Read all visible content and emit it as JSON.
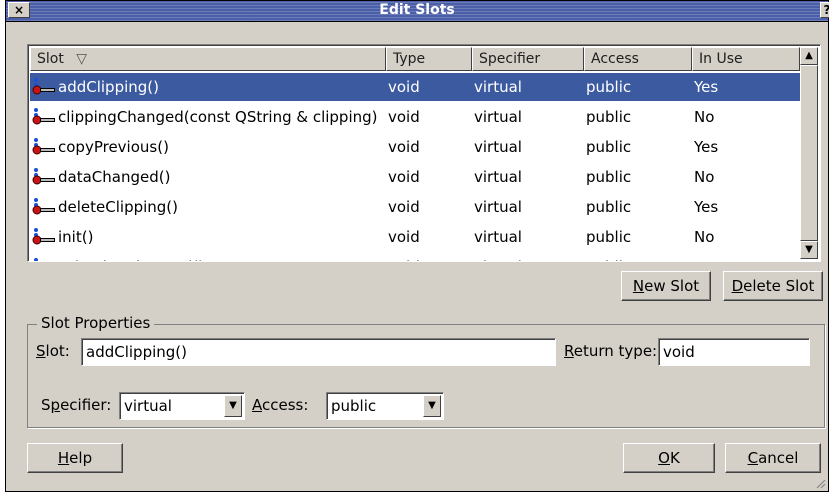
{
  "window": {
    "title": "Edit Slots",
    "close_glyph": "×",
    "help_glyph": "?"
  },
  "slot_list": {
    "columns": [
      {
        "label": "Slot",
        "sort_glyph": "▽"
      },
      {
        "label": "Type"
      },
      {
        "label": "Specifier"
      },
      {
        "label": "Access"
      },
      {
        "label": "In Use"
      }
    ],
    "rows": [
      {
        "slot": "addClipping()",
        "type": "void",
        "specifier": "virtual",
        "access": "public",
        "in_use": "Yes",
        "selected": true
      },
      {
        "slot": "clippingChanged(const QString & clipping)",
        "type": "void",
        "specifier": "virtual",
        "access": "public",
        "in_use": "No"
      },
      {
        "slot": "copyPrevious()",
        "type": "void",
        "specifier": "virtual",
        "access": "public",
        "in_use": "Yes"
      },
      {
        "slot": "dataChanged()",
        "type": "void",
        "specifier": "virtual",
        "access": "public",
        "in_use": "No"
      },
      {
        "slot": "deleteClipping()",
        "type": "void",
        "specifier": "virtual",
        "access": "public",
        "in_use": "Yes"
      },
      {
        "slot": "init()",
        "type": "void",
        "specifier": "virtual",
        "access": "public",
        "in_use": "No"
      },
      {
        "slot": "selectionChanged()",
        "type": "void",
        "specifier": "virtual",
        "access": "public",
        "in_use": "No"
      }
    ],
    "scroll_up_glyph": "▲",
    "scroll_down_glyph": "▼"
  },
  "buttons": {
    "new_slot": {
      "mnemonic": "N",
      "rest": "ew Slot"
    },
    "delete_slot": {
      "mnemonic": "D",
      "rest": "elete Slot"
    },
    "help": {
      "mnemonic": "H",
      "rest": "elp"
    },
    "ok": {
      "mnemonic": "O",
      "rest": "K"
    },
    "cancel": {
      "mnemonic": "C",
      "rest": "ancel"
    }
  },
  "properties": {
    "group_label": "Slot Properties",
    "slot_label": {
      "mnemonic": "S",
      "rest": "lot:"
    },
    "slot_value": "addClipping()",
    "return_type_label": {
      "mnemonic": "R",
      "rest": "eturn type:"
    },
    "return_type_value": "void",
    "specifier_label": {
      "pre": "S",
      "mnemonic": "p",
      "rest": "ecifier:"
    },
    "specifier_value": "virtual",
    "access_label": {
      "mnemonic": "A",
      "rest": "ccess:"
    },
    "access_value": "public",
    "combo_arrow_glyph": "▼"
  },
  "colors": {
    "selection": "#3b5aa0",
    "titlebar": "#4a5fa8",
    "dialog_bg": "#d4d0c8"
  },
  "icons": {
    "slot_row": "slot-connector-icon"
  }
}
